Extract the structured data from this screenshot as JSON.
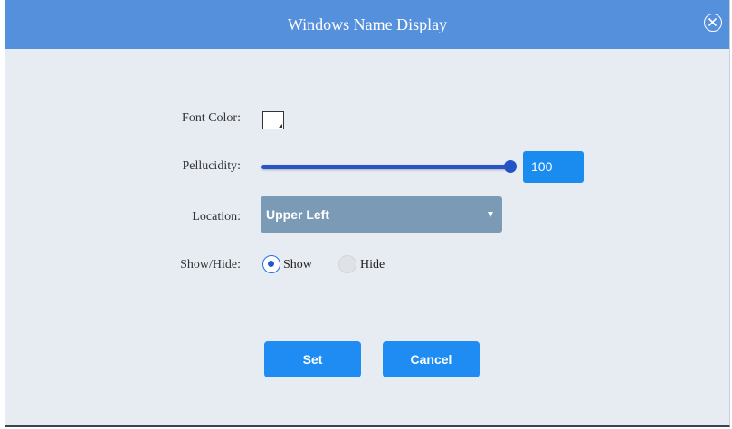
{
  "dialog": {
    "title": "Windows Name Display",
    "close_icon": "close-circle-icon"
  },
  "font_color": {
    "label": "Font Color:",
    "value": "#ffffff"
  },
  "pellucidity": {
    "label": "Pellucidity:",
    "value": "100",
    "level_percent": 100,
    "track_color": "#2655c7"
  },
  "location": {
    "label": "Location:",
    "selected": "Upper Left"
  },
  "show_hide": {
    "label": "Show/Hide:",
    "options": [
      {
        "label": "Show",
        "checked": true
      },
      {
        "label": "Hide",
        "checked": false
      }
    ]
  },
  "buttons": {
    "set_label": "Set",
    "cancel_label": "Cancel",
    "color": "#1f8cf3"
  },
  "colors": {
    "titlebar": "#5590dd",
    "background": "#e7ebf2",
    "select": "#7a9ab6"
  }
}
